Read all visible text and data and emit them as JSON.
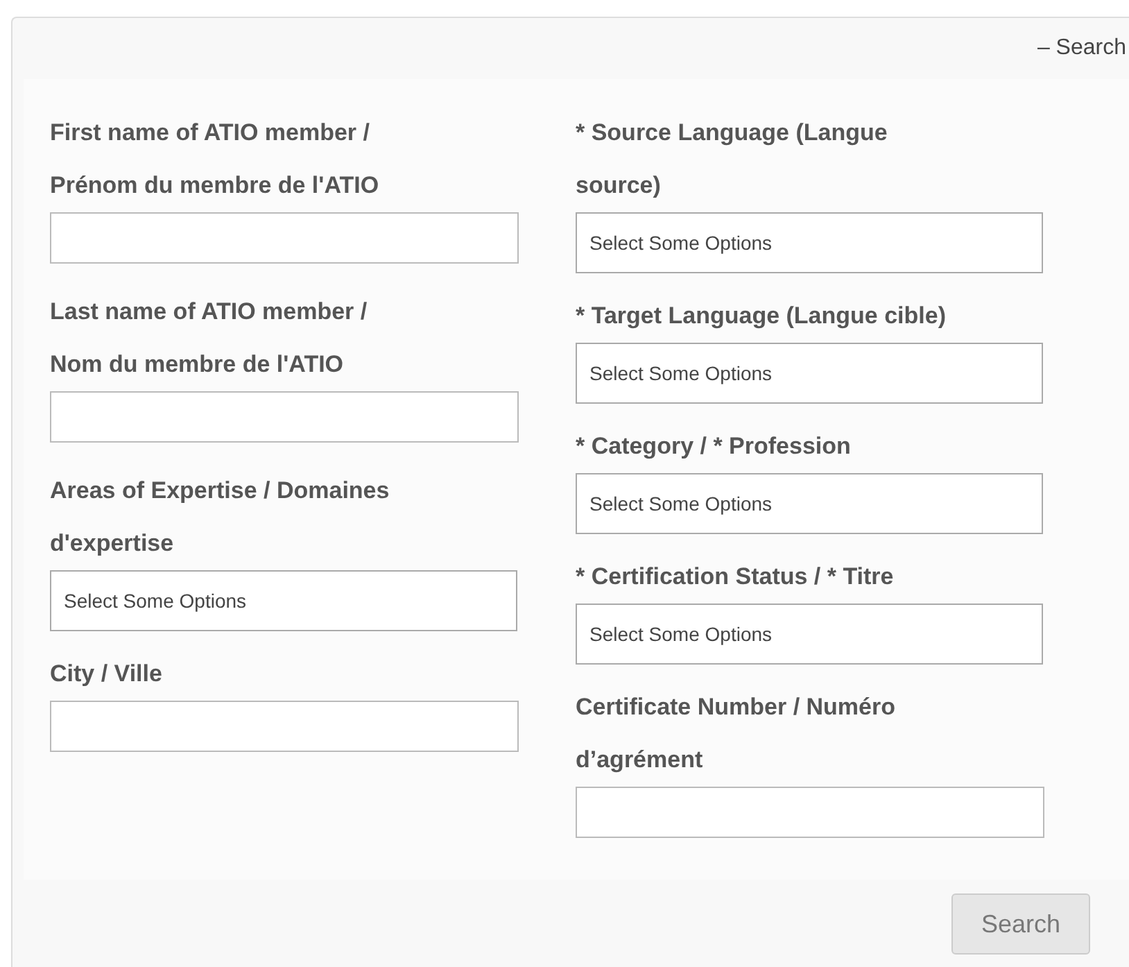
{
  "toggle_link": "– Search",
  "columns": [
    [
      {
        "kind": "text",
        "label_lines": [
          "First name of ATIO member /",
          "Prénom du membre de l'ATIO"
        ]
      },
      {
        "kind": "text",
        "label_lines": [
          "Last name of ATIO member /",
          "Nom du membre de l'ATIO"
        ]
      },
      {
        "kind": "select",
        "label_lines": [
          "Areas of Expertise / Domaines",
          "d'expertise"
        ],
        "placeholder": "Select Some Options"
      },
      {
        "kind": "text",
        "label_lines": [
          "City / Ville"
        ]
      }
    ],
    [
      {
        "kind": "select",
        "label_lines": [
          "* Source Language (Langue",
          "source)"
        ],
        "placeholder": "Select Some Options"
      },
      {
        "kind": "select",
        "label_lines": [
          "* Target Language (Langue cible)"
        ],
        "placeholder": "Select Some Options"
      },
      {
        "kind": "select",
        "label_lines": [
          "* Category / * Profession"
        ],
        "placeholder": "Select Some Options"
      },
      {
        "kind": "select",
        "label_lines": [
          "* Certification Status / * Titre"
        ],
        "placeholder": "Select Some Options"
      },
      {
        "kind": "text",
        "label_lines": [
          "Certificate Number / Numéro",
          "d’agrément"
        ]
      }
    ]
  ],
  "search_button": "Search"
}
